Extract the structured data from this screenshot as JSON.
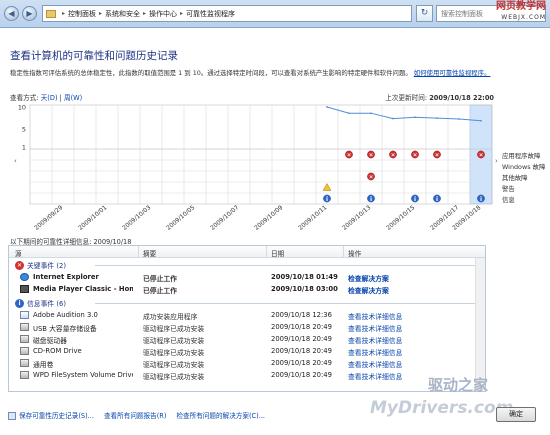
{
  "watermark_top": {
    "line1": "网页教学网",
    "line2": "WEBJX.COM"
  },
  "watermark_bottom": {
    "brand": "驱动之家",
    "site": "MyDrivers.com"
  },
  "address": {
    "segments": [
      "控制面板",
      "系统和安全",
      "操作中心",
      "可靠性监视程序"
    ]
  },
  "search": {
    "placeholder": "搜索控制面板"
  },
  "header": {
    "title": "查看计算机的可靠性和问题历史记录",
    "description": "稳定性指数可评估系统的总体稳定性，此指数的取值范围是 1 到 10。通过选择特定时间段，可以查看对系统产生影响的特定硬件和软件问题。",
    "link": "如何使用可靠性监视程序。"
  },
  "view": {
    "label": "查看方式:",
    "day": "天(D)",
    "sep": "|",
    "week": "周(W)"
  },
  "last_update": {
    "label": "上次更新时间:",
    "value": "2009/10/18 22:00"
  },
  "categories": [
    "应用程序故障",
    "Windows 故障",
    "其他故障",
    "警告",
    "信息"
  ],
  "chart_data": {
    "type": "line",
    "title": "",
    "ylim": [
      1,
      10
    ],
    "yticks": [
      "10",
      "5",
      "1"
    ],
    "x": [
      "",
      "2009/09/29",
      "",
      "2009/10/01",
      "",
      "2009/10/03",
      "",
      "2009/10/05",
      "",
      "2009/10/07",
      "",
      "2009/10/09",
      "",
      "2009/10/11",
      "",
      "2009/10/13",
      "",
      "2009/10/15",
      "",
      "2009/10/17",
      "2009/10/18"
    ],
    "series": [
      {
        "values": [
          null,
          null,
          null,
          null,
          null,
          null,
          null,
          null,
          null,
          null,
          null,
          null,
          null,
          10.0,
          8.6,
          8.6,
          7.4,
          7.7,
          7.5,
          7.3,
          6.9
        ]
      }
    ],
    "selected_index": 20,
    "events": {
      "app_failure": [
        14,
        15,
        16,
        17,
        18,
        20
      ],
      "other_failure": [
        15
      ],
      "warning": [
        13
      ],
      "information": [
        13,
        15,
        17,
        18,
        20
      ]
    }
  },
  "selected_caption": "以下期间的可靠性详细信息: 2009/10/18",
  "table": {
    "headers": [
      "源",
      "摘要",
      "日期",
      "操作"
    ],
    "groups": [
      {
        "label": "关键事件 (2)",
        "rows": [
          {
            "source": "Internet Explorer",
            "summary": "已停止工作",
            "date": "2009/10/18 01:49",
            "action": "检查解决方案",
            "bold": true
          },
          {
            "source": "Media Player Classic - Homec...",
            "summary": "已停止工作",
            "date": "2009/10/18 03:00",
            "action": "检查解决方案",
            "bold": true
          }
        ]
      },
      {
        "label": "信息事件 (6)",
        "rows": [
          {
            "source": "Adobe Audition 3.0",
            "summary": "成功安装应用程序",
            "date": "2009/10/18 12:36",
            "action": "查看技术详细信息"
          },
          {
            "source": "USB 大容量存储设备",
            "summary": "驱动程序已成功安装",
            "date": "2009/10/18 20:49",
            "action": "查看技术详细信息"
          },
          {
            "source": "磁盘驱动器",
            "summary": "驱动程序已成功安装",
            "date": "2009/10/18 20:49",
            "action": "查看技术详细信息"
          },
          {
            "source": "CD-ROM Drive",
            "summary": "驱动程序已成功安装",
            "date": "2009/10/18 20:49",
            "action": "查看技术详细信息"
          },
          {
            "source": "通用卷",
            "summary": "驱动程序已成功安装",
            "date": "2009/10/18 20:49",
            "action": "查看技术详细信息"
          },
          {
            "source": "WPD FileSystem Volume Driver",
            "summary": "驱动程序已成功安装",
            "date": "2009/10/18 20:49",
            "action": "查看技术详细信息"
          }
        ]
      }
    ]
  },
  "bottom_links": [
    "保存可靠性历史记录(S)...",
    "查看所有问题报告(R)",
    "检查所有问题的解决方案(C)..."
  ],
  "ok_button": "确定"
}
